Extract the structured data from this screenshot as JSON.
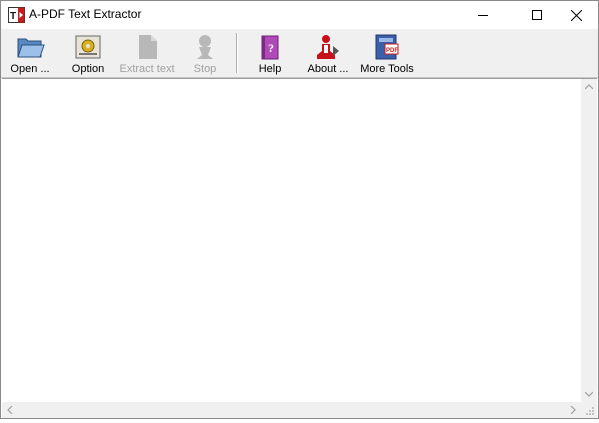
{
  "window": {
    "title": "A-PDF Text Extractor",
    "app_icon": "app-logo-icon"
  },
  "window_controls": {
    "minimize": "minimize-icon",
    "maximize": "maximize-icon",
    "close": "close-icon"
  },
  "toolbar": {
    "open_label": "Open ...",
    "option_label": "Option",
    "extract_label": "Extract text",
    "stop_label": "Stop",
    "help_label": "Help",
    "about_label": "About ...",
    "more_tools_label": "More Tools",
    "icons": {
      "open": "folder-open-icon",
      "option": "options-icon",
      "extract": "extract-page-icon",
      "stop": "stop-icon",
      "help": "help-book-icon",
      "about": "about-person-icon",
      "more_tools": "more-tools-icon"
    },
    "disabled": [
      "extract_label",
      "stop_label"
    ]
  },
  "content": {
    "text": ""
  },
  "colors": {
    "toolbar_bg": "#f0f0f0",
    "disabled_text": "#a0a0a0",
    "help_purple": "#b04ab8",
    "about_red": "#c8101a",
    "more_tools_blue": "#3a5ea8"
  }
}
